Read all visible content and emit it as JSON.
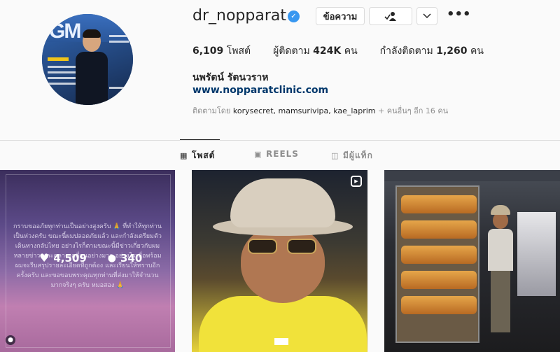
{
  "profile": {
    "username": "dr_nopparat",
    "verified_icon": "verified-badge-icon",
    "message_label": "ข้อความ",
    "follow_icon": "person-check-icon",
    "dropdown_icon": "chevron-down-icon",
    "more_icon": "more-options-icon",
    "stats": {
      "posts_count": "6,109",
      "posts_label": "โพสต์",
      "followers_label": "ผู้ติดตาม",
      "followers_count": "424K",
      "followers_unit": "คน",
      "following_label": "กำลังติดตาม",
      "following_count": "1,260",
      "following_unit": "คน"
    },
    "full_name": "นพรัตน์ รัตนวราห",
    "website": "www.nopparatclinic.com",
    "followed_by_prefix": "ติดตามโดย",
    "followed_by_names": "korysecret, mamsurivipa, kae_laprim",
    "followed_by_suffix": "+ คนอื่นๆ อีก 16 คน"
  },
  "tabs": [
    {
      "label": "โพสต์",
      "icon": "grid-icon",
      "active": true
    },
    {
      "label": "REELS",
      "icon": "reels-icon",
      "active": false
    },
    {
      "label": "มีผู้แท็ก",
      "icon": "tagged-icon",
      "active": false
    }
  ],
  "posts": [
    {
      "type": "image",
      "text": "กราบขออภัยทุกท่านเป็นอย่างสูงครับ 🙏 ที่ทำให้ทุกท่านเป็นห่วงครับ ขณะนี้ผมปลอดภัยแล้ว และกำลังเตรียมตัวเดินทางกลับไทย อย่างไรก็ตามขณะนี้มีข่าวเกี่ยวกับผมหลายข่าว และคลาดเคลื่อนอย่างมาก อย่างไรเมื่อพร้อมผมจะรีบสรุปรายละเอียดที่ถูกต้อง และเรียนให้ทราบอีกครั้งครับ และขอขอบพระคุณทุกท่านที่ส่งมาให้จำนวนมากจริงๆ ครับ หมอสอง 🙏",
      "likes": "4,509",
      "comments": "340"
    },
    {
      "type": "reel"
    },
    {
      "type": "image"
    }
  ]
}
